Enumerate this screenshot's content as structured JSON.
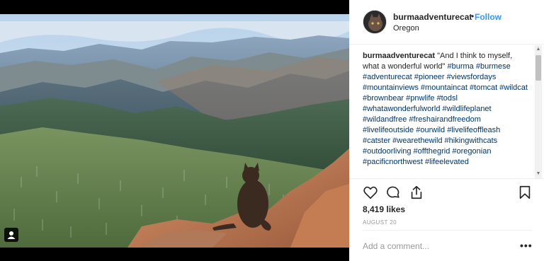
{
  "post": {
    "username": "burmaadventurecat",
    "separator": "•",
    "follow_label": "Follow",
    "location": "Oregon",
    "caption_username": "burmaadventurecat",
    "caption_text": "\"And I think to myself, what a wonderful world\"",
    "hashtags": "#burma #burmese #adventurecat #pioneer #viewsfordays #mountainviews #mountaincat #tomcat #wildcat #brownbear #pnwlife #todsl #whatawonderfulworld #wildlifeplanet #wildandfree #freshairandfreedom #livelifeoutside #ourwild #livelifeoffleash #catster #wearethewild #hikingwithcats #outdoorliving #offthegrid #oregonian #pacificnorthwest #lifeelevated",
    "likes": "8,419 likes",
    "date": "AUGUST 20",
    "comment_placeholder": "Add a comment...",
    "more_label": "•••"
  },
  "icons": {
    "like": "heart-icon",
    "comment": "comment-bubble-icon",
    "share": "share-icon",
    "save": "bookmark-icon",
    "tag": "user-tag-icon"
  },
  "colors": {
    "follow": "#3897f0",
    "hashtag": "#003569",
    "text": "#262626",
    "muted": "#999999"
  }
}
